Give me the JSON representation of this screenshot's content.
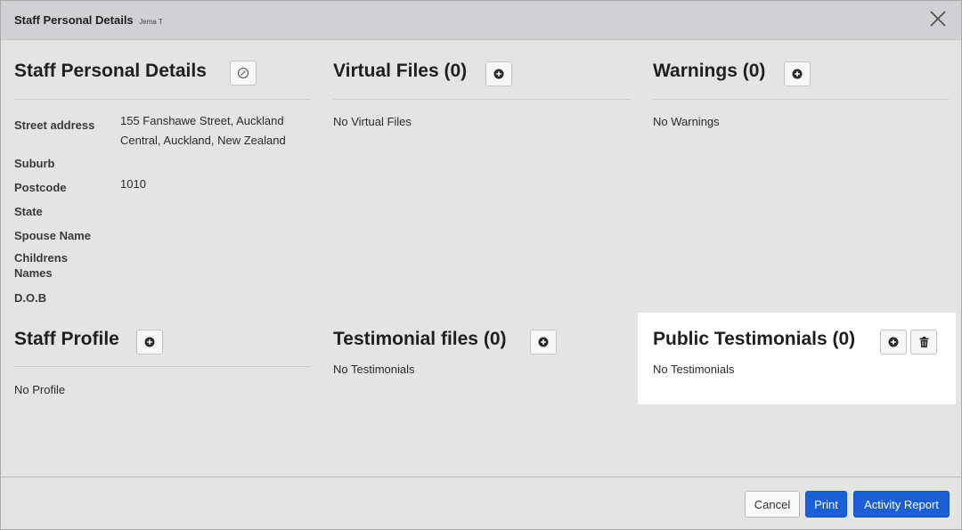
{
  "modal": {
    "title": "Staff Personal Details",
    "subtitle": "Jema T"
  },
  "personal": {
    "title": "Staff Personal Details",
    "fields": [
      {
        "label": "Street address",
        "value": "155 Fanshawe Street, Auckland Central, Auckland, New Zealand"
      },
      {
        "label": "Suburb",
        "value": ""
      },
      {
        "label": "Postcode",
        "value": "1010"
      },
      {
        "label": "State",
        "value": ""
      },
      {
        "label": "Spouse Name",
        "value": ""
      },
      {
        "label": "Childrens Names",
        "value": ""
      },
      {
        "label": "D.O.B",
        "value": ""
      }
    ]
  },
  "virtual_files": {
    "title": "Virtual Files (0)",
    "empty": "No Virtual Files"
  },
  "warnings": {
    "title": "Warnings (0)",
    "empty": "No Warnings"
  },
  "staff_profile": {
    "title": "Staff Profile",
    "empty": "No Profile"
  },
  "testimonial_files": {
    "title": "Testimonial files (0)",
    "empty": "No Testimonials"
  },
  "public_testimonials": {
    "title": "Public Testimonials (0)",
    "empty": "No Testimonials"
  },
  "footer": {
    "cancel": "Cancel",
    "print": "Print",
    "activity_report": "Activity Report"
  },
  "colors": {
    "primary_button": "#1a5fd6",
    "header_bg": "#cfd1d4",
    "body_bg": "#e4e4e4"
  },
  "icons": {
    "close": "close-icon",
    "edit": "edit-icon",
    "add": "plus-circle-icon",
    "delete": "trash-icon"
  }
}
